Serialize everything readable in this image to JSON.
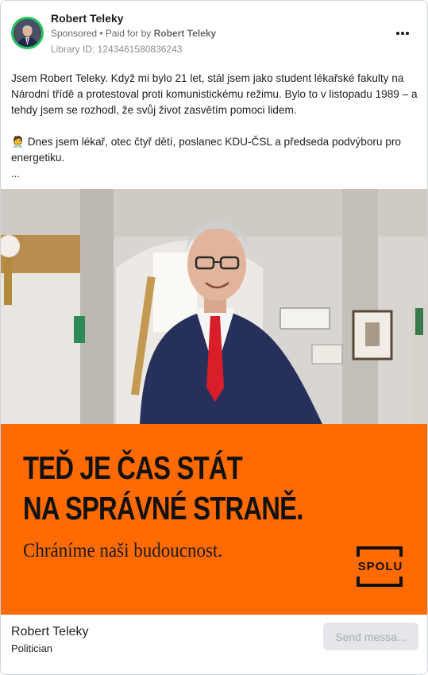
{
  "header": {
    "page_name": "Robert Teleky",
    "sponsored_label": "Sponsored",
    "separator": " • ",
    "paid_for_prefix": "Paid for by ",
    "paid_for_name": "Robert Teleky",
    "library_id": "Library ID: 1243461580836243",
    "more_icon": "more-horizontal-icon"
  },
  "post": {
    "paragraph_1": "Jsem Robert Teleky. Když mi bylo 21 let, stál jsem jako student lékařské fakulty na Národní třídě a protestoval proti komunistickému režimu. Bylo to v listopadu 1989 – a tehdy jsem se rozhodl, že svůj život zasvětím pomoci lidem.",
    "paragraph_2": "🧑‍⚕️ Dnes jsem lékař, otec čtyř dětí, poslanec KDU-ČSL a předseda podvýboru pro energetiku.",
    "ellipsis": "..."
  },
  "ad_image": {
    "headline_line_1": "TEĎ JE ČAS STÁT",
    "headline_line_2": "NA SPRÁVNÉ STRANĚ.",
    "subline": "Chráníme naši budoucnost.",
    "logo_text": "SPOLU",
    "banner_color": "#ff6b00"
  },
  "footer": {
    "name": "Robert Teleky",
    "category": "Politician",
    "send_button": "Send messa..."
  }
}
